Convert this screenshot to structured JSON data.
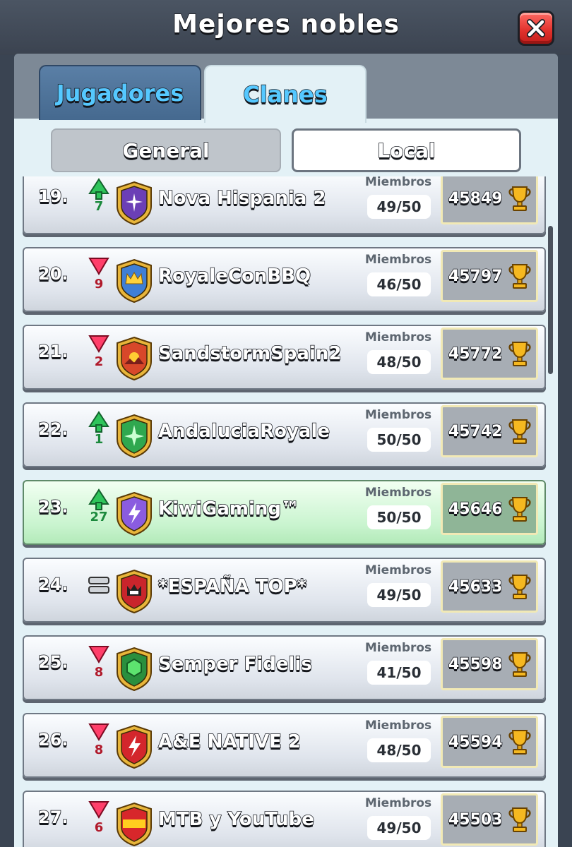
{
  "header": {
    "title": "Mejores nobles"
  },
  "tabs": {
    "jugadores": "Jugadores",
    "clanes": "Clanes"
  },
  "toggles": {
    "general": "General",
    "local": "Local"
  },
  "colors": {
    "up": "#1c8a3d",
    "down": "#b0192a",
    "highlight": "#c9f4cf"
  },
  "list": {
    "members_label": "Miembros",
    "rows": [
      {
        "rank": "19.",
        "trend": "up",
        "change": "7",
        "badge": "purple-star",
        "name": "Nova Hispania 2",
        "members": "49/50",
        "trophies": "45849"
      },
      {
        "rank": "20.",
        "trend": "down",
        "change": "9",
        "badge": "blue-crown",
        "name": "RoyaleConBBQ",
        "members": "46/50",
        "trophies": "45797"
      },
      {
        "rank": "21.",
        "trend": "down",
        "change": "2",
        "badge": "sunset",
        "name": "SandstormSpain2",
        "members": "48/50",
        "trophies": "45772"
      },
      {
        "rank": "22.",
        "trend": "up",
        "change": "1",
        "badge": "green-star",
        "name": "AndaluciaRoyale",
        "members": "50/50",
        "trophies": "45742"
      },
      {
        "rank": "23.",
        "trend": "up",
        "change": "27",
        "badge": "purple-bolt",
        "name": "KiwiGaming™",
        "members": "50/50",
        "trophies": "45646",
        "highlight": true
      },
      {
        "rank": "24.",
        "trend": "same",
        "change": "",
        "badge": "red-crown",
        "name": "*ESPAÑA TOP*",
        "members": "49/50",
        "trophies": "45633"
      },
      {
        "rank": "25.",
        "trend": "down",
        "change": "8",
        "badge": "green-gem",
        "name": "Semper Fidelis",
        "members": "41/50",
        "trophies": "45598"
      },
      {
        "rank": "26.",
        "trend": "down",
        "change": "8",
        "badge": "red-bolt",
        "name": "A&E NATIVE 2",
        "members": "48/50",
        "trophies": "45594"
      },
      {
        "rank": "27.",
        "trend": "down",
        "change": "6",
        "badge": "spain-flag",
        "name": "MTB y YouTube",
        "members": "49/50",
        "trophies": "45503"
      }
    ]
  }
}
